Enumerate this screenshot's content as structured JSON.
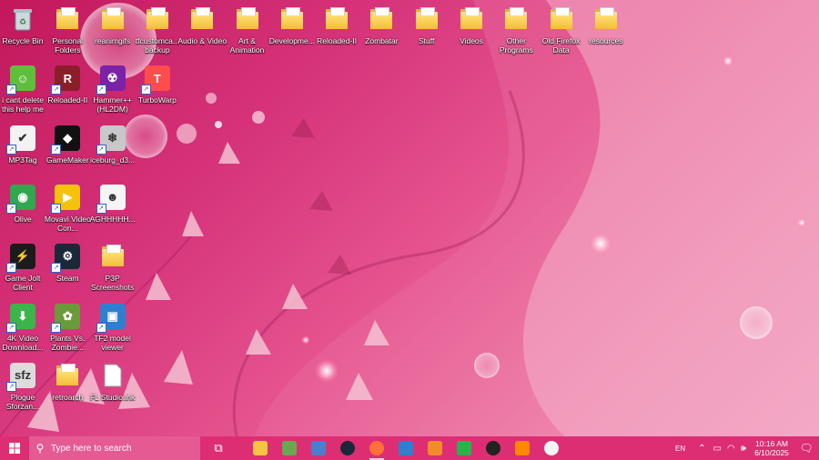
{
  "desktop": {
    "icons": [
      {
        "label": "Recycle Bin",
        "type": "bin",
        "col": 0,
        "row": 0
      },
      {
        "label": "i cant delete this help me",
        "type": "app",
        "color": "#5fbf3b",
        "glyph": "☺",
        "col": 0,
        "row": 1
      },
      {
        "label": "MP3Tag",
        "type": "app",
        "color": "#f2f2f2",
        "glyph": "✔",
        "col": 0,
        "row": 2
      },
      {
        "label": "Olive",
        "type": "app",
        "color": "#2fa84f",
        "glyph": "◉",
        "col": 0,
        "row": 3
      },
      {
        "label": "Game Jolt Client",
        "type": "app",
        "color": "#1b1b1b",
        "glyph": "⚡",
        "col": 0,
        "row": 4
      },
      {
        "label": "4K Video Download...",
        "type": "app",
        "color": "#3bb54a",
        "glyph": "⬇",
        "col": 0,
        "row": 5
      },
      {
        "label": "Plogue Sforzan...",
        "type": "app",
        "color": "#dcdcdc",
        "glyph": "sfz",
        "col": 0,
        "row": 6
      },
      {
        "label": "Personal Folders",
        "type": "folder",
        "col": 1,
        "row": 0
      },
      {
        "label": "Reloaded-II",
        "type": "app",
        "color": "#8a1f2a",
        "glyph": "R",
        "col": 1,
        "row": 1
      },
      {
        "label": "GameMaker",
        "type": "app",
        "color": "#111111",
        "glyph": "◆",
        "col": 1,
        "row": 2
      },
      {
        "label": "Movavi Video Con...",
        "type": "app",
        "color": "#f4c20d",
        "glyph": "▶",
        "col": 1,
        "row": 3
      },
      {
        "label": "Steam",
        "type": "app",
        "color": "#1b2838",
        "glyph": "⚙",
        "col": 1,
        "row": 4
      },
      {
        "label": "Plants Vs. Zombie...",
        "type": "app",
        "color": "#6a9a3a",
        "glyph": "✿",
        "col": 1,
        "row": 5
      },
      {
        "label": "retroarch",
        "type": "folder",
        "col": 1,
        "row": 6
      },
      {
        "label": "reanimgifs",
        "type": "folder",
        "col": 2,
        "row": 0
      },
      {
        "label": "Hammer++ (HL2DM)",
        "type": "app",
        "color": "#7a22a8",
        "glyph": "☢",
        "col": 2,
        "row": 1
      },
      {
        "label": "iceburg_d3...",
        "type": "app",
        "color": "#c8c8c8",
        "glyph": "❄",
        "col": 2,
        "row": 2
      },
      {
        "label": "AGHHHHH...",
        "type": "app",
        "color": "#f5f5f5",
        "glyph": "☻",
        "col": 2,
        "row": 3
      },
      {
        "label": "P3P Screenshots",
        "type": "folder",
        "col": 2,
        "row": 4
      },
      {
        "label": "TF2 model viewer",
        "type": "app",
        "color": "#2f7fd0",
        "glyph": "▣",
        "col": 2,
        "row": 5
      },
      {
        "label": "FL Studio.lnk",
        "type": "file",
        "col": 2,
        "row": 6
      },
      {
        "label": "tfcustomca... backup",
        "type": "folder",
        "col": 3,
        "row": 0
      },
      {
        "label": "TurboWarp",
        "type": "app",
        "color": "#ff4c4c",
        "glyph": "T",
        "col": 3,
        "row": 1
      },
      {
        "label": "Audio & Video",
        "type": "folder",
        "col": 4,
        "row": 0
      },
      {
        "label": "Art & Animation",
        "type": "folder",
        "col": 5,
        "row": 0
      },
      {
        "label": "Developme...",
        "type": "folder",
        "col": 6,
        "row": 0
      },
      {
        "label": "Reloaded-II",
        "type": "folder",
        "col": 7,
        "row": 0
      },
      {
        "label": "Zombatar",
        "type": "folder",
        "col": 8,
        "row": 0
      },
      {
        "label": "Stuff",
        "type": "folder",
        "col": 9,
        "row": 0
      },
      {
        "label": "Videos",
        "type": "folder",
        "col": 10,
        "row": 0
      },
      {
        "label": "Other Programs",
        "type": "folder",
        "col": 11,
        "row": 0
      },
      {
        "label": "Old Firefox Data",
        "type": "folder",
        "col": 12,
        "row": 0
      },
      {
        "label": "resources",
        "type": "folder",
        "col": 13,
        "row": 0
      }
    ]
  },
  "taskbar": {
    "search_placeholder": "Type here to search",
    "pinned": [
      {
        "name": "task-view-icon",
        "color": "transparent",
        "glyph": "⧉",
        "running": false
      },
      {
        "name": "file-explorer-icon",
        "color": "#f5c444",
        "glyph": "",
        "running": false
      },
      {
        "name": "minecraft-icon",
        "color": "#6aa84f",
        "glyph": "",
        "running": false
      },
      {
        "name": "paint-net-icon",
        "color": "#4a7fd0",
        "glyph": "",
        "running": false
      },
      {
        "name": "steam-icon",
        "color": "#1b2838",
        "glyph": "",
        "running": false
      },
      {
        "name": "firefox-icon",
        "color": "#ff7139",
        "glyph": "",
        "running": true
      },
      {
        "name": "tf2-model-viewer-icon",
        "color": "#2f7fd0",
        "glyph": "",
        "running": false
      },
      {
        "name": "fl-studio-icon",
        "color": "#f28c28",
        "glyph": "",
        "running": false
      },
      {
        "name": "razer-cortex-icon",
        "color": "#2bb34a",
        "glyph": "",
        "running": false
      },
      {
        "name": "obs-icon",
        "color": "#222222",
        "glyph": "",
        "running": false
      },
      {
        "name": "vlc-icon",
        "color": "#ff8800",
        "glyph": "",
        "running": false
      },
      {
        "name": "penguin-icon",
        "color": "#f5f5f5",
        "glyph": "",
        "running": false
      }
    ],
    "tray": {
      "language": "EN",
      "time": "10:16 AM",
      "date": "6/10/2025"
    }
  }
}
